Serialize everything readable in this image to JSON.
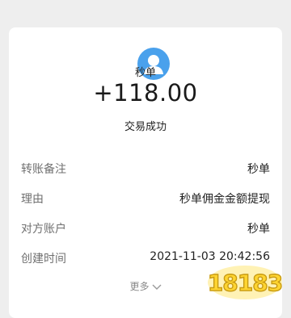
{
  "transaction": {
    "payee": "秒单",
    "amount": "+118.00",
    "status": "交易成功"
  },
  "details": [
    {
      "label": "转账备注",
      "value": "秒单"
    },
    {
      "label": "理由",
      "value": "秒单佣金金额提现"
    },
    {
      "label": "对方账户",
      "value": "秒单"
    },
    {
      "label": "创建时间",
      "value": "2021-11-03 20:42:56"
    }
  ],
  "more_label": "更多",
  "icons": {
    "avatar": "user-avatar-icon",
    "expand": "chevron-down-icon",
    "watermark": "18183-watermark-logo"
  },
  "watermark": {
    "text": "18183"
  },
  "colors": {
    "avatar_bg": "#4aa1ec",
    "card_bg": "#ffffff",
    "page_bg": "#eeeeee",
    "watermark_fill": "#ffd531"
  }
}
